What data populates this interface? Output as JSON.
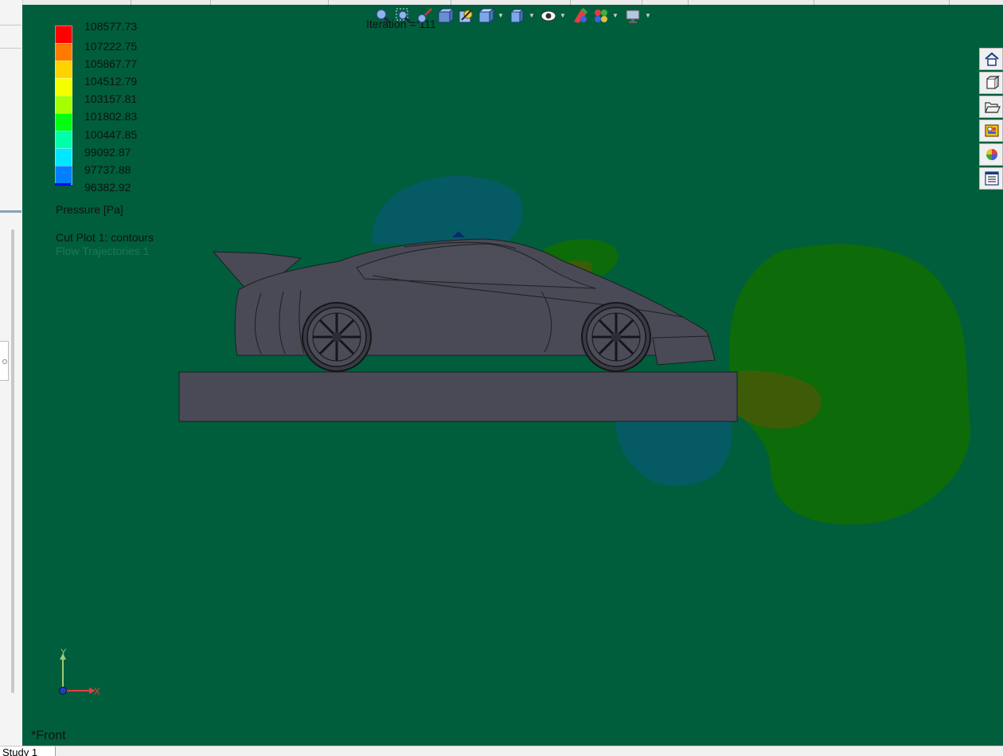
{
  "viewport": {
    "iteration_label": "Iteration = 111",
    "view_label": "*Front",
    "legend": {
      "values": [
        "108577.73",
        "107222.75",
        "105867.77",
        "104512.79",
        "103157.81",
        "101802.83",
        "100447.85",
        "99092.87",
        "97737.88",
        "96382.92"
      ],
      "colors": [
        "#ff0000",
        "#ff7a00",
        "#ffd200",
        "#f4ff00",
        "#a6ff00",
        "#00ff10",
        "#00ffa8",
        "#00e8ff",
        "#0080ff",
        "#0000ff"
      ],
      "quantity": "Pressure [Pa]",
      "plot_name": "Cut Plot 1: contours",
      "trajectories": "Flow Trajectories 1"
    },
    "triad": {
      "x_label": "X",
      "y_label": "Y"
    },
    "colors": {
      "background": "#005e3c",
      "body": "#4a4a56",
      "region_green": "#0d6b0a",
      "region_teal": "#065a64",
      "region_olive": "#3e5c08"
    }
  },
  "toolbar": {
    "icons": [
      "zoom-to-fit-icon",
      "zoom-to-area-icon",
      "previous-view-icon",
      "section-view-icon",
      "view-orientation-icon",
      "display-style-icon",
      "hide-show-items-icon",
      "edit-appearance-icon",
      "apply-scene-icon",
      "view-settings-icon"
    ]
  },
  "task_pane": {
    "icons": [
      "home-icon",
      "3d-box-icon",
      "folder-icon",
      "view-palette-icon",
      "appearances-icon",
      "custom-properties-icon"
    ]
  },
  "statusbar": {
    "tab_label": "Study 1"
  }
}
